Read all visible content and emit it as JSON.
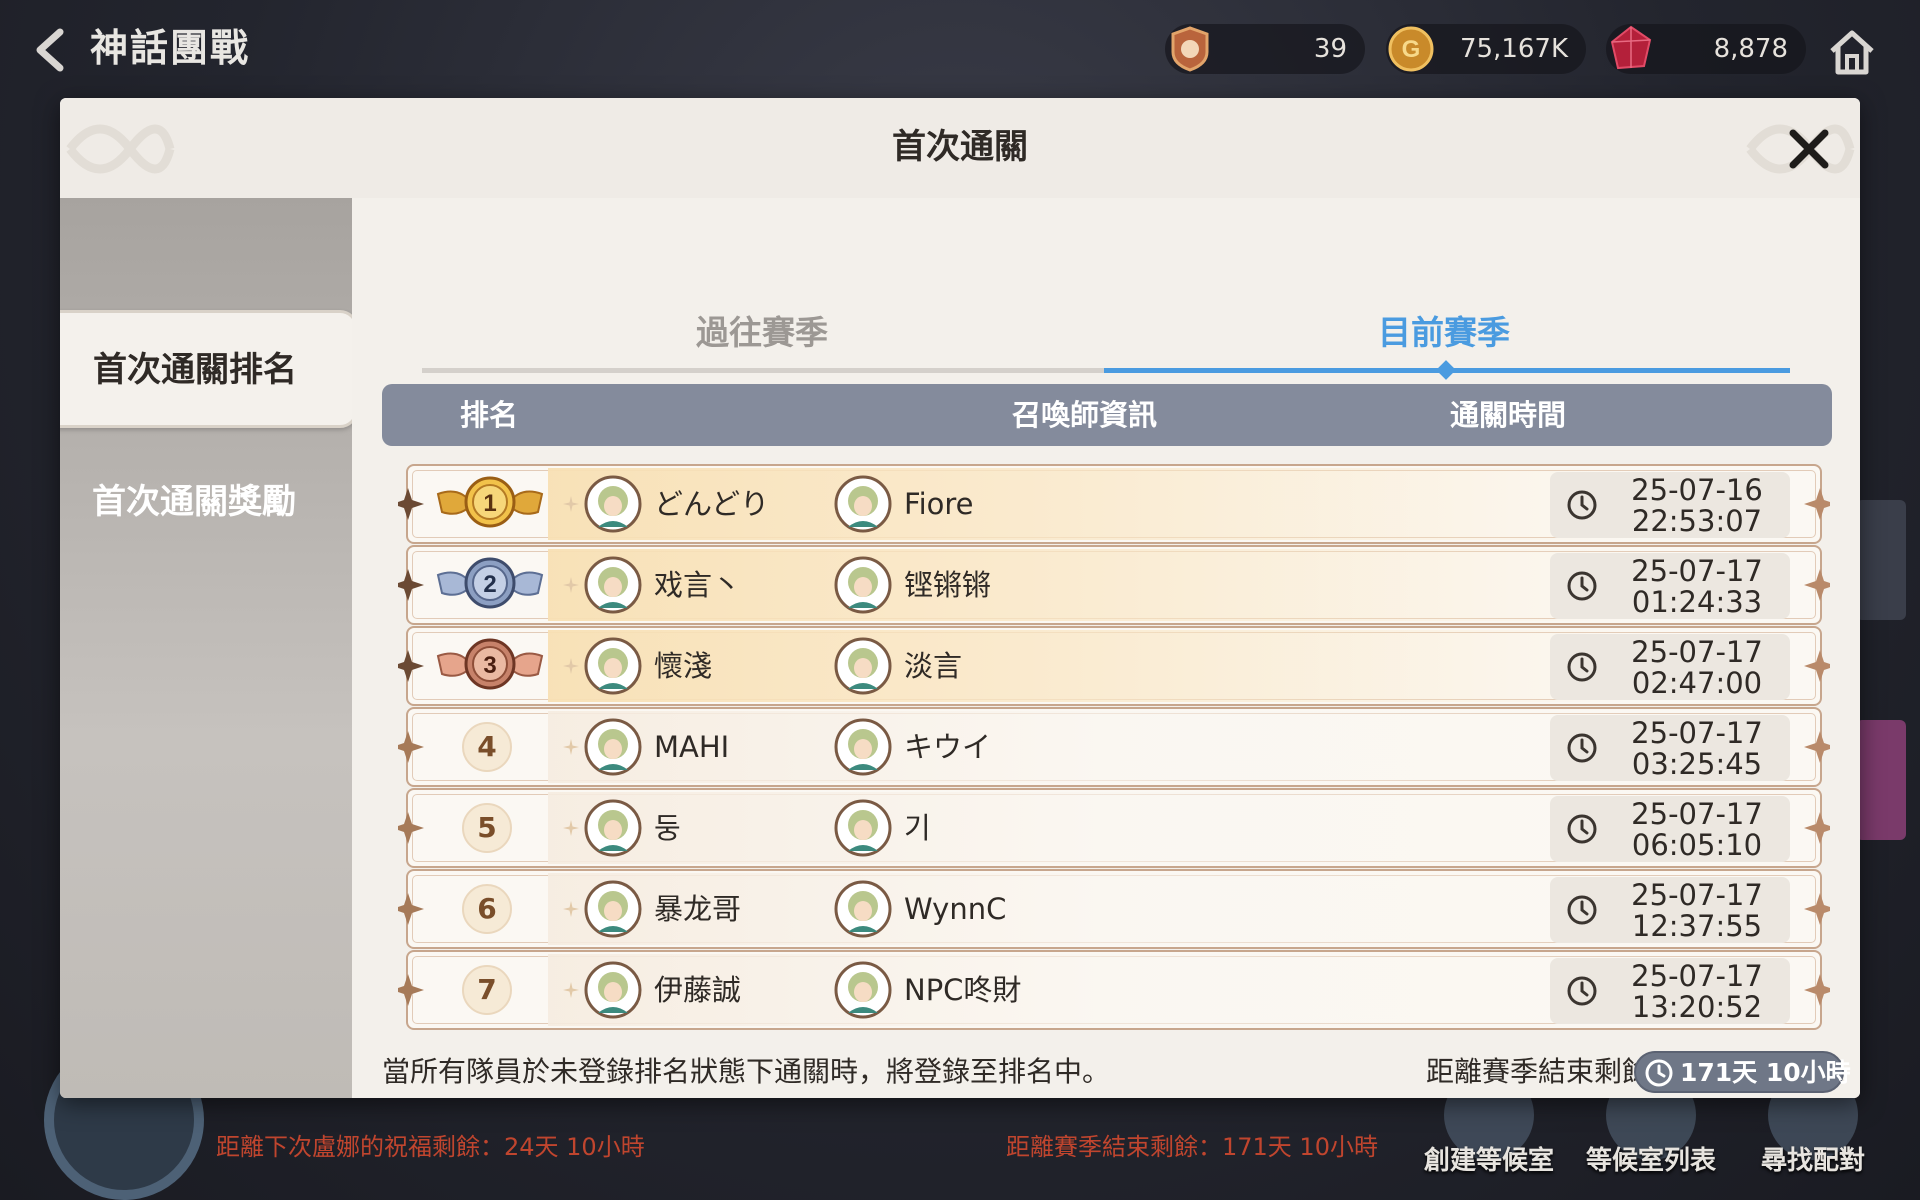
{
  "topbar": {
    "title": "神話團戰",
    "currencies": [
      {
        "icon": "medal-token-icon",
        "value": "39"
      },
      {
        "icon": "gold-coin-icon",
        "value": "75,167K"
      },
      {
        "icon": "red-gem-icon",
        "value": "8,878"
      }
    ]
  },
  "lobby": {
    "blessing_text": "距離下次盧娜的祝福剩餘：24天 10小時",
    "season_text": "距離賽季結束剩餘：171天 10小時",
    "buttons": [
      "創建等候室",
      "等候室列表",
      "尋找配對"
    ]
  },
  "modal": {
    "title": "首次通關",
    "sidebar": [
      "首次通關排名",
      "首次通關獎勵"
    ],
    "tabs": {
      "past": "過往賽季",
      "current": "目前賽季"
    },
    "columns": {
      "rank": "排名",
      "summoner": "召喚師資訊",
      "time": "通關時間"
    },
    "rows": [
      {
        "rank": "1",
        "player1": "どんどり",
        "player2": "Fiore",
        "date": "25-07-16",
        "time": "22:53:07"
      },
      {
        "rank": "2",
        "player1": "戏言丶",
        "player2": "铿锵锵",
        "date": "25-07-17",
        "time": "01:24:33"
      },
      {
        "rank": "3",
        "player1": "懷淺",
        "player2": "淡言",
        "date": "25-07-17",
        "time": "02:47:00"
      },
      {
        "rank": "4",
        "player1": "MAHI",
        "player2": "キウイ",
        "date": "25-07-17",
        "time": "03:25:45"
      },
      {
        "rank": "5",
        "player1": "둥",
        "player2": "기",
        "date": "25-07-17",
        "time": "06:05:10"
      },
      {
        "rank": "6",
        "player1": "暴龙哥",
        "player2": "WynnC",
        "date": "25-07-17",
        "time": "12:37:55"
      },
      {
        "rank": "7",
        "player1": "伊藤誠",
        "player2": "NPC咚財",
        "date": "25-07-17",
        "time": "13:20:52"
      }
    ],
    "footnote": "當所有隊員於未登錄排名狀態下通關時，將登錄至排名中。",
    "season_remaining_label": "距離賽季結束剩餘",
    "season_remaining_value": "171天 10小時"
  },
  "colors": {
    "accent_blue": "#4a9be0",
    "header_gray": "#848b9c",
    "gold": "#e0a83a",
    "silver": "#8c9fc2",
    "bronze": "#c7826a"
  }
}
